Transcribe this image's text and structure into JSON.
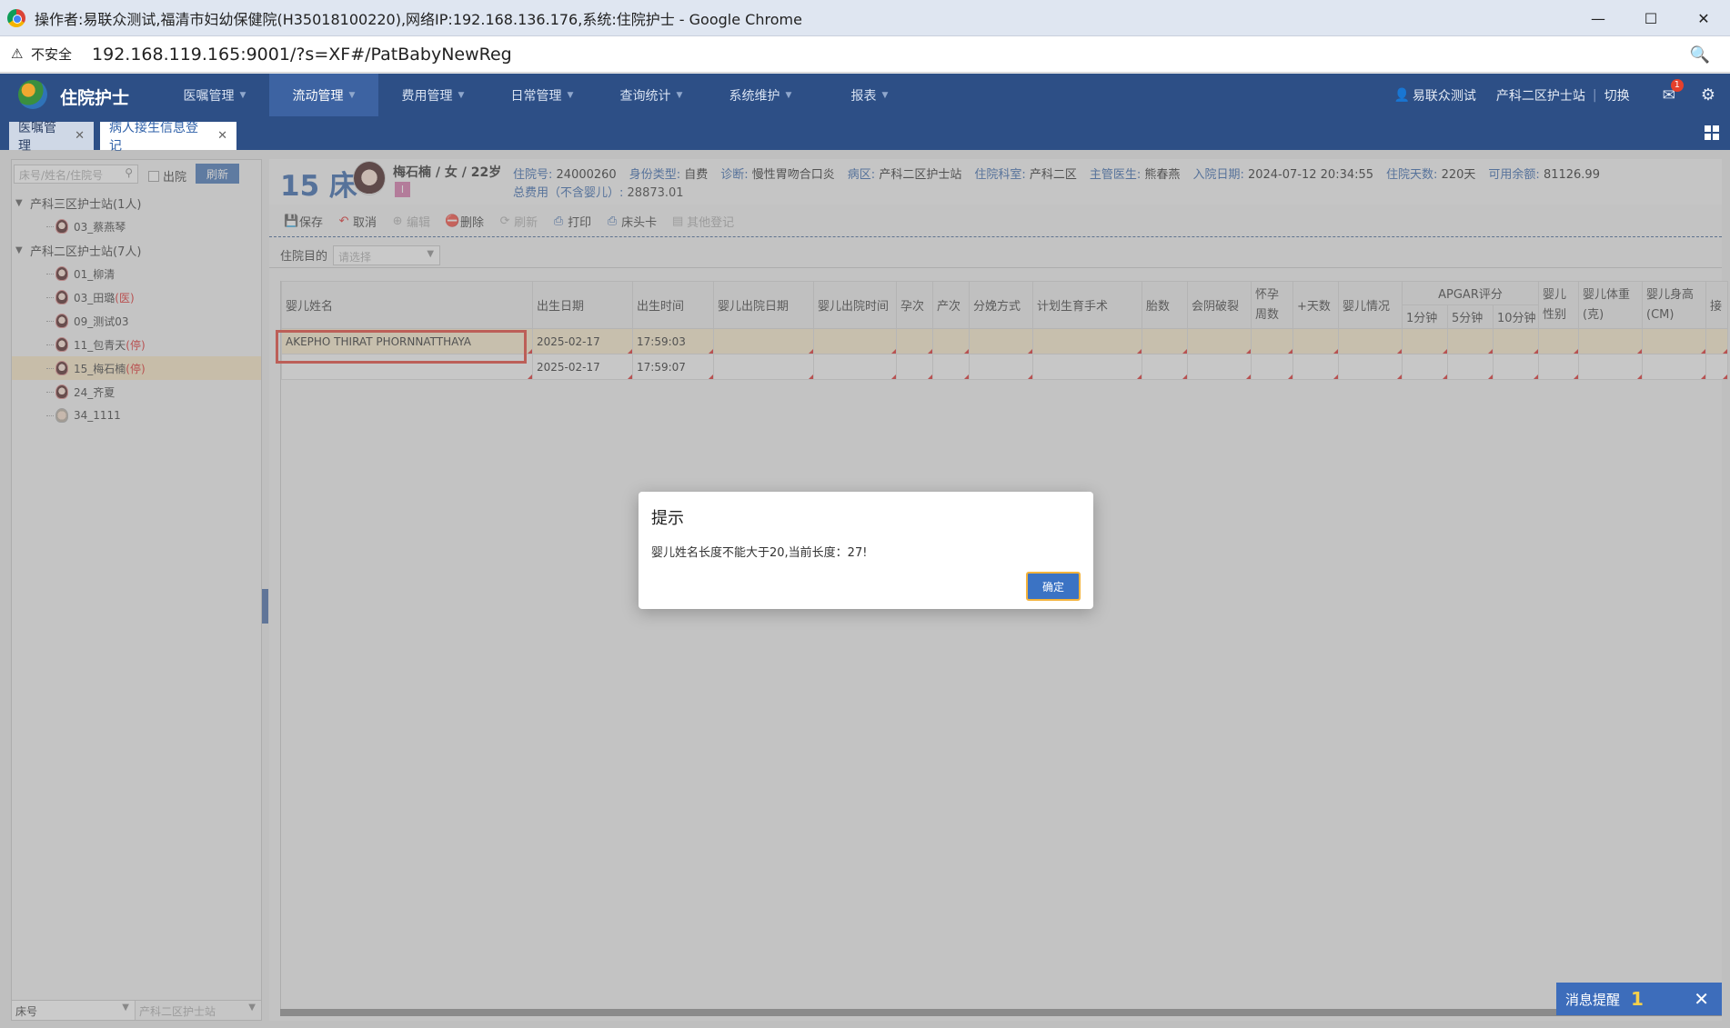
{
  "window": {
    "title": "操作者:易联众测试,福清市妇幼保健院(H35018100220),网络IP:192.168.136.176,系统:住院护士 - Google Chrome",
    "min": "—",
    "max": "☐",
    "close": "✕"
  },
  "address": {
    "insecure": "不安全",
    "url": "192.168.119.165:9001/?s=XF#/PatBabyNewReg"
  },
  "app": {
    "name": "住院护士",
    "menu": [
      "医嘱管理",
      "流动管理",
      "费用管理",
      "日常管理",
      "查询统计",
      "系统维护",
      "报表"
    ],
    "user": "易联众测试",
    "station": "产科二区护士站",
    "switch": "切换",
    "mail_badge": "1"
  },
  "tabs": [
    {
      "label": "医嘱管理",
      "close": "✕"
    },
    {
      "label": "病人接生信息登记",
      "close": "✕"
    }
  ],
  "left": {
    "search_placeholder": "床号/姓名/住院号",
    "discharged_label": "出院",
    "refresh_label": "刷新",
    "groups": [
      {
        "label": "产科三区护士站(1人)",
        "items": [
          {
            "name": "03_蔡燕琴",
            "tag": ""
          }
        ]
      },
      {
        "label": "产科二区护士站(7人)",
        "items": [
          {
            "name": "01_柳清",
            "tag": ""
          },
          {
            "name": "03_田璐",
            "tag": "(医)"
          },
          {
            "name": "09_测试03",
            "tag": ""
          },
          {
            "name": "11_包青天",
            "tag": "(停)"
          },
          {
            "name": "15_梅石楠",
            "tag": "(停)"
          },
          {
            "name": "24_齐夏",
            "tag": ""
          },
          {
            "name": "34_1111",
            "tag": ""
          }
        ]
      }
    ],
    "footer_sort": "床号",
    "footer_station": "产科二区护士站"
  },
  "patient": {
    "bed": "15 床",
    "name": "梅石楠 / 女 / 22岁",
    "level": "I",
    "fields": [
      {
        "k": "住院号:",
        "v": "24000260"
      },
      {
        "k": "身份类型:",
        "v": "自费"
      },
      {
        "k": "诊断:",
        "v": "慢性胃吻合口炎"
      },
      {
        "k": "病区:",
        "v": "产科二区护士站"
      },
      {
        "k": "住院科室:",
        "v": "产科二区"
      },
      {
        "k": "主管医生:",
        "v": "熊春燕"
      },
      {
        "k": "入院日期:",
        "v": "2024-07-12 20:34:55"
      },
      {
        "k": "住院天数:",
        "v": "220天"
      },
      {
        "k": "可用余额:",
        "v": "81126.99"
      }
    ],
    "total_k": "总费用（不含婴儿）:",
    "total_v": "28873.01"
  },
  "toolbar": {
    "save": "保存",
    "cancel": "取消",
    "edit": "编辑",
    "delete": "删除",
    "refresh": "刷新",
    "print": "打印",
    "bedcard": "床头卡",
    "other": "其他登记"
  },
  "purpose": {
    "label": "住院目的",
    "placeholder": "请选择"
  },
  "grid": {
    "headers": {
      "name": "婴儿姓名",
      "birth_date": "出生日期",
      "birth_time": "出生时间",
      "out_date": "婴儿出院日期",
      "out_time": "婴儿出院时间",
      "gravida": "孕次",
      "para": "产次",
      "delivery": "分娩方式",
      "planned": "计划生育手术",
      "fetus": "胎数",
      "perineum": "会阴破裂",
      "weeks": "怀孕周数",
      "days": "+天数",
      "status": "婴儿情况",
      "apgar": "APGAR评分",
      "apgar1": "1分钟",
      "apgar5": "5分钟",
      "apgar10": "10分钟",
      "sex": "婴儿性别",
      "weight": "婴儿体重(克)",
      "height": "婴儿身高(CM)",
      "more": "接"
    },
    "rows": [
      {
        "name": "AKEPHO THIRAT PHORNNATTHAYA",
        "date": "2025-02-17",
        "time": "17:59:03"
      },
      {
        "name": "",
        "date": "2025-02-17",
        "time": "17:59:07"
      }
    ]
  },
  "dialog": {
    "title": "提示",
    "message": "婴儿姓名长度不能大于20,当前长度：27!",
    "ok": "确定"
  },
  "toast": {
    "label": "消息提醒",
    "count": "1",
    "close": "✕"
  }
}
